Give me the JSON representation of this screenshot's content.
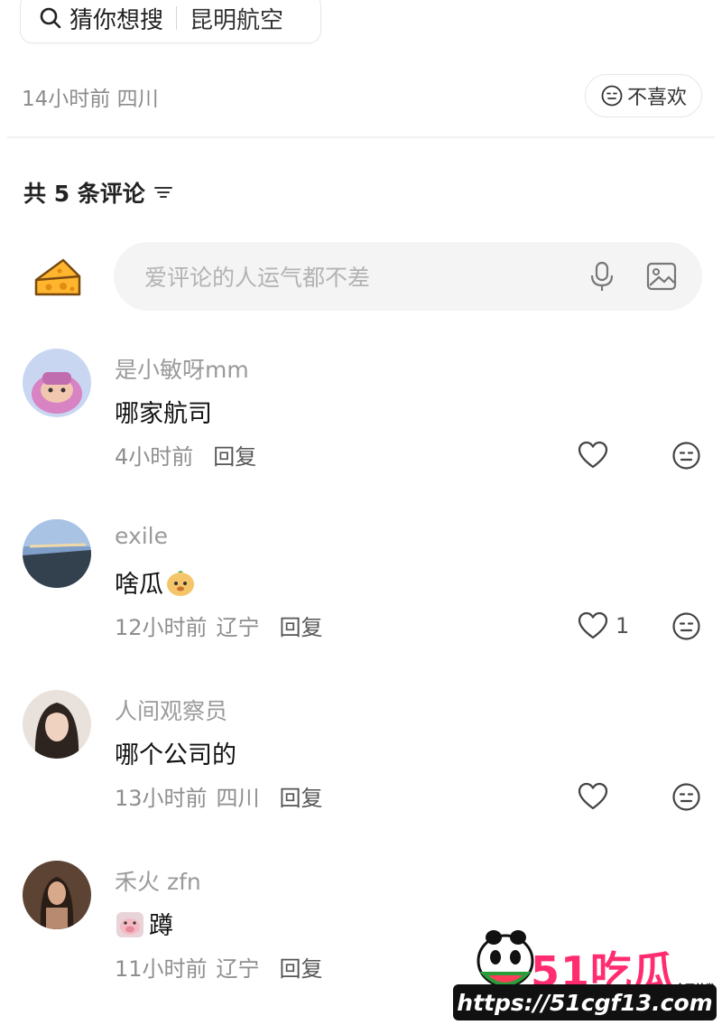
{
  "search": {
    "prefix": "猜你想搜",
    "keyword": "昆明航空"
  },
  "post_meta": {
    "time_location": "14小时前 四川",
    "dislike_label": "不喜欢"
  },
  "comments_header": {
    "count_text": "共 5 条评论"
  },
  "composer": {
    "placeholder": "爱评论的人运气都不差"
  },
  "comments": [
    {
      "username": "是小敏呀mm",
      "text": "哪家航司",
      "time": "4小时前",
      "location": "",
      "reply": "回复",
      "likes": "",
      "avatar_color": "#b9a6e0"
    },
    {
      "username": "exile",
      "text": "啥瓜",
      "time": "12小时前",
      "location": "辽宁",
      "reply": "回复",
      "likes": "1",
      "avatar_color": "#6f8fb8"
    },
    {
      "username": "人间观察员",
      "text": "哪个公司的",
      "time": "13小时前",
      "location": "四川",
      "reply": "回复",
      "likes": "",
      "avatar_color": "#3a2c26"
    },
    {
      "username": "禾火 zfn",
      "text": "蹲",
      "time": "11小时前",
      "location": "辽宁",
      "reply": "回复",
      "likes": "",
      "avatar_color": "#4a3528"
    }
  ],
  "watermark": {
    "logo": "51吃瓜",
    "tag": "全网首发",
    "url": "https://51cgf13.com"
  },
  "colors": {
    "text_primary": "#222222",
    "text_secondary": "#8e8e8e",
    "composer_bg": "#f4f4f4",
    "watermark_pink": "#ff2d6f"
  }
}
